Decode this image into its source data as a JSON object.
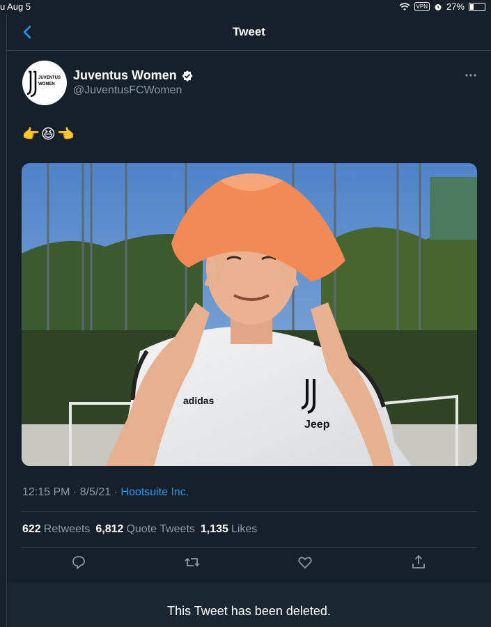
{
  "status_bar": {
    "date": "u Aug 5",
    "vpn": "VPN",
    "battery": "27%"
  },
  "nav": {
    "title": "Tweet"
  },
  "tweet": {
    "author_name": "Juventus Women",
    "handle": "@JuventusFCWomen",
    "avatar_text": [
      "JUVENTUS",
      "WOMEN"
    ],
    "emojis": [
      "👉",
      "😆",
      "👈"
    ],
    "photo_text": {
      "brand": "adidas",
      "sponsor": "Jeep"
    },
    "time": "12:15 PM",
    "date": "8/5/21",
    "source": "Hootsuite Inc.",
    "stats": {
      "retweets_count": "622",
      "retweets_label": "Retweets",
      "quotes_count": "6,812",
      "quotes_label": "Quote Tweets",
      "likes_count": "1,135",
      "likes_label": "Likes"
    }
  },
  "deleted_notice": "This Tweet has been deleted.",
  "colors": {
    "background": "#15202b",
    "accent": "#1d9bf0",
    "muted": "#8b98a5",
    "divider": "#38444d"
  }
}
